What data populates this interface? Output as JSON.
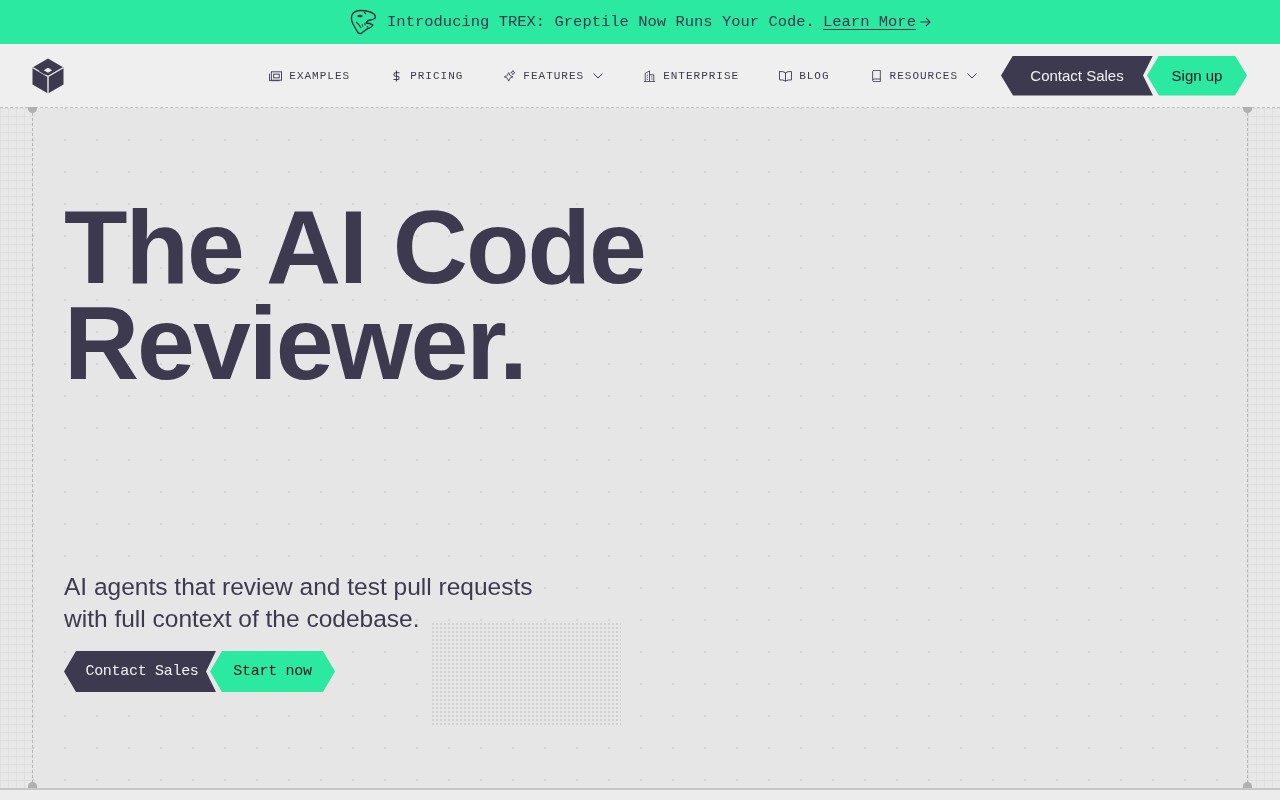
{
  "announcement": {
    "text": "Introducing TREX: Greptile Now Runs Your Code.",
    "link": "Learn More"
  },
  "nav": {
    "items": [
      {
        "label": "EXAMPLES",
        "dropdown": false
      },
      {
        "label": "PRICING",
        "dropdown": false
      },
      {
        "label": "FEATURES",
        "dropdown": true
      },
      {
        "label": "ENTERPRISE",
        "dropdown": false
      },
      {
        "label": "BLOG",
        "dropdown": false
      },
      {
        "label": "RESOURCES",
        "dropdown": true
      }
    ],
    "buttons": [
      {
        "label": "Contact Sales",
        "kind": "dark"
      },
      {
        "label": "Sign up",
        "kind": "accent"
      }
    ]
  },
  "hero": {
    "heading_lines": [
      "The AI Code",
      "Reviewer."
    ],
    "subtitle": "AI agents that review and test pull requests with full context of the codebase.",
    "buttons": [
      {
        "label": "Contact Sales",
        "kind": "dark"
      },
      {
        "label": "Start now",
        "kind": "accent"
      }
    ]
  }
}
